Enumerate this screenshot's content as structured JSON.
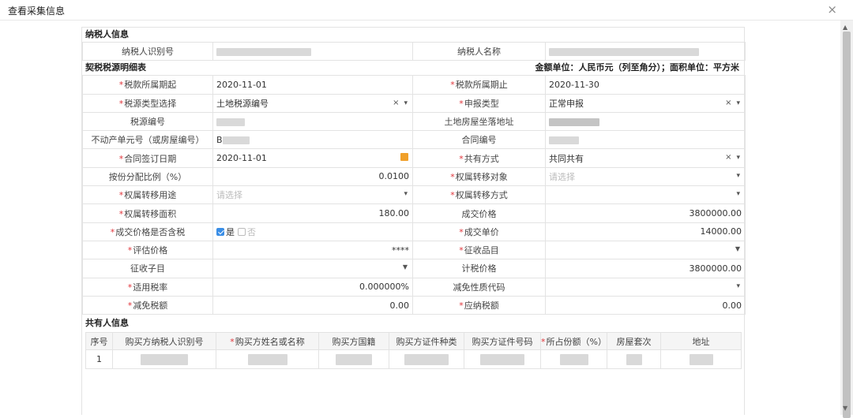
{
  "dialog": {
    "title": "查看采集信息",
    "close_icon": "×"
  },
  "taxpayer": {
    "section_title": "纳税人信息",
    "id_label": "纳税人识别号",
    "name_label": "纳税人名称"
  },
  "detail": {
    "section_title": "契税税源明细表",
    "unit_note": "金额单位：人民币元（列至角分）；面积单位：平方米",
    "rows": [
      {
        "l1": "税款所属期起",
        "r1": true,
        "v1": "2020-11-01",
        "l2": "税款所属期止",
        "r2": true,
        "v2": "2020-11-30"
      },
      {
        "l1": "税源类型选择",
        "r1": true,
        "v1": "土地税源编号",
        "l2": "申报类型",
        "r2": true,
        "v2": "正常申报"
      },
      {
        "l1": "税源编号",
        "r1": false,
        "v1": "",
        "l2": "土地房屋坐落地址",
        "r2": false,
        "v2": ""
      },
      {
        "l1": "不动产单元号（或房屋编号）",
        "r1": false,
        "v1": "B",
        "l2": "合同编号",
        "r2": false,
        "v2": ""
      },
      {
        "l1": "合同签订日期",
        "r1": true,
        "v1": "2020-11-01",
        "l2": "共有方式",
        "r2": true,
        "v2": "共同共有"
      },
      {
        "l1": "按份分配比例（%）",
        "r1": false,
        "v1": "0.0100",
        "l2": "权属转移对象",
        "r2": true,
        "v2": "请选择"
      },
      {
        "l1": "权属转移用途",
        "r1": true,
        "v1": "请选择",
        "l2": "权属转移方式",
        "r2": true,
        "v2": ""
      },
      {
        "l1": "权属转移面积",
        "r1": true,
        "v1": "180.00",
        "l2": "成交价格",
        "r2": false,
        "v2": "3800000.00"
      },
      {
        "l1": "成交价格是否含税",
        "r1": true,
        "v1": "",
        "l2": "成交单价",
        "r2": true,
        "v2": "14000.00"
      },
      {
        "l1": "评估价格",
        "r1": true,
        "v1": "****",
        "l2": "征收品目",
        "r2": true,
        "v2": ""
      },
      {
        "l1": "征收子目",
        "r1": false,
        "v1": "",
        "l2": "计税价格",
        "r2": false,
        "v2": "3800000.00"
      },
      {
        "l1": "适用税率",
        "r1": true,
        "v1": "0.000000%",
        "l2": "减免性质代码",
        "r2": false,
        "v2": ""
      },
      {
        "l1": "减免税额",
        "r1": true,
        "v1": "0.00",
        "l2": "应纳税额",
        "r2": true,
        "v2": "0.00"
      }
    ],
    "tax_incl_yes": "是",
    "tax_incl_no": "否"
  },
  "coowners": {
    "section_title": "共有人信息",
    "headers": [
      "序号",
      "购买方纳税人识别号",
      "购买方姓名或名称",
      "购买方国籍",
      "购买方证件种类",
      "购买方证件号码",
      "所占份额（%）",
      "房屋套次",
      "地址"
    ],
    "rows": [
      {
        "no": "1"
      }
    ]
  },
  "icons": {
    "close": "close-icon",
    "calendar": "calendar-icon",
    "dropdown": "chevron-down-icon",
    "clear": "clear-icon"
  }
}
